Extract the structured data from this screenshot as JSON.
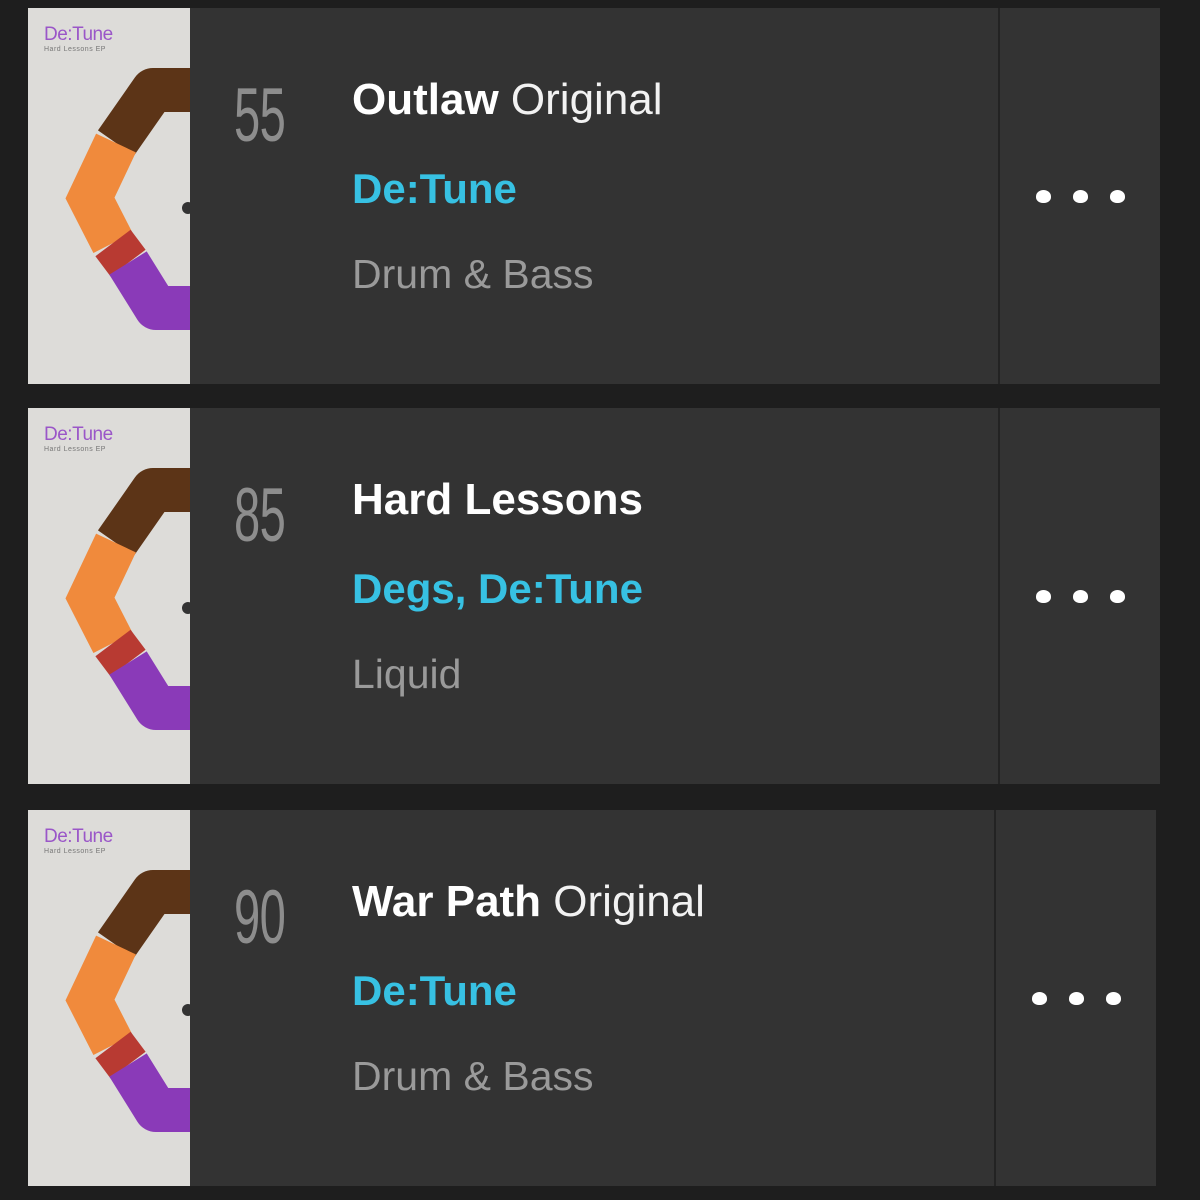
{
  "tracks": [
    {
      "rank": "55",
      "title": "Outlaw",
      "mix": "Original",
      "artists": "De:Tune",
      "genre": "Drum & Bass",
      "artwork": {
        "label": "De:Tune",
        "sub": "Hard Lessons EP"
      },
      "menu_icon": "more-dots-icon"
    },
    {
      "rank": "85",
      "title": "Hard Lessons",
      "mix": "",
      "artists": "Degs, De:Tune",
      "genre": "Liquid",
      "artwork": {
        "label": "De:Tune",
        "sub": "Hard Lessons EP"
      },
      "menu_icon": "more-dots-icon"
    },
    {
      "rank": "90",
      "title": "War Path",
      "mix": "Original",
      "artists": "De:Tune",
      "genre": "Drum & Bass",
      "artwork": {
        "label": "De:Tune",
        "sub": "Hard Lessons EP"
      },
      "menu_icon": "more-dots-icon"
    }
  ],
  "colors": {
    "background": "#1e1e1e",
    "row": "#333333",
    "artist": "#37c1e3",
    "rank": "#8d8d8d",
    "genre": "#9a9a9a",
    "title": "#ffffff"
  }
}
